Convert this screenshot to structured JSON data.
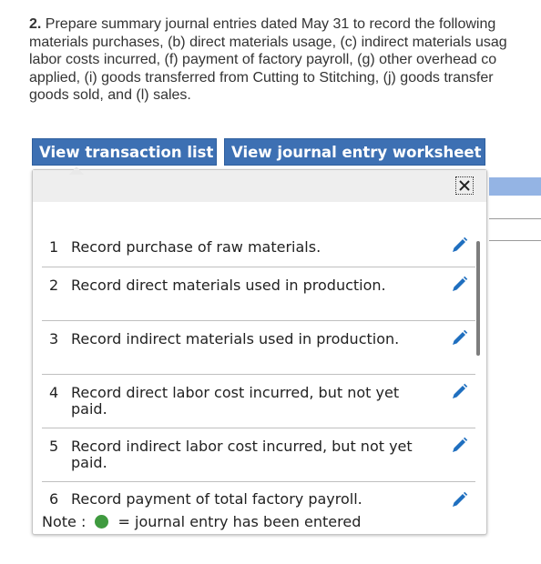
{
  "question": {
    "number": "2.",
    "lines": [
      " Prepare summary journal entries dated May 31 to record the following",
      "materials purchases, (b) direct materials usage, (c) indirect materials usag",
      "labor costs incurred, (f) payment of factory payroll, (g) other overhead co",
      "applied, (i) goods transferred from Cutting to Stitching, (j) goods transfer",
      "goods sold, and (l) sales."
    ]
  },
  "tabs": {
    "transaction_list": "View transaction list",
    "journal_worksheet": "View journal entry worksheet"
  },
  "transactions": [
    {
      "num": "1",
      "text": "Record purchase of raw materials."
    },
    {
      "num": "2",
      "text": "Record direct materials used in production."
    },
    {
      "num": "3",
      "text": "Record indirect materials used in production."
    },
    {
      "num": "4",
      "text": "Record direct labor cost incurred, but not yet paid."
    },
    {
      "num": "5",
      "text": "Record indirect labor cost incurred, but not yet paid."
    },
    {
      "num": "6",
      "text": "Record payment of total factory payroll."
    }
  ],
  "note": {
    "prefix": "Note :",
    "suffix": "= journal entry has been entered",
    "dot_color": "#3f9a3f"
  },
  "colors": {
    "tab_bg": "#3d70b3",
    "edit_icon": "#1f6fbf"
  }
}
